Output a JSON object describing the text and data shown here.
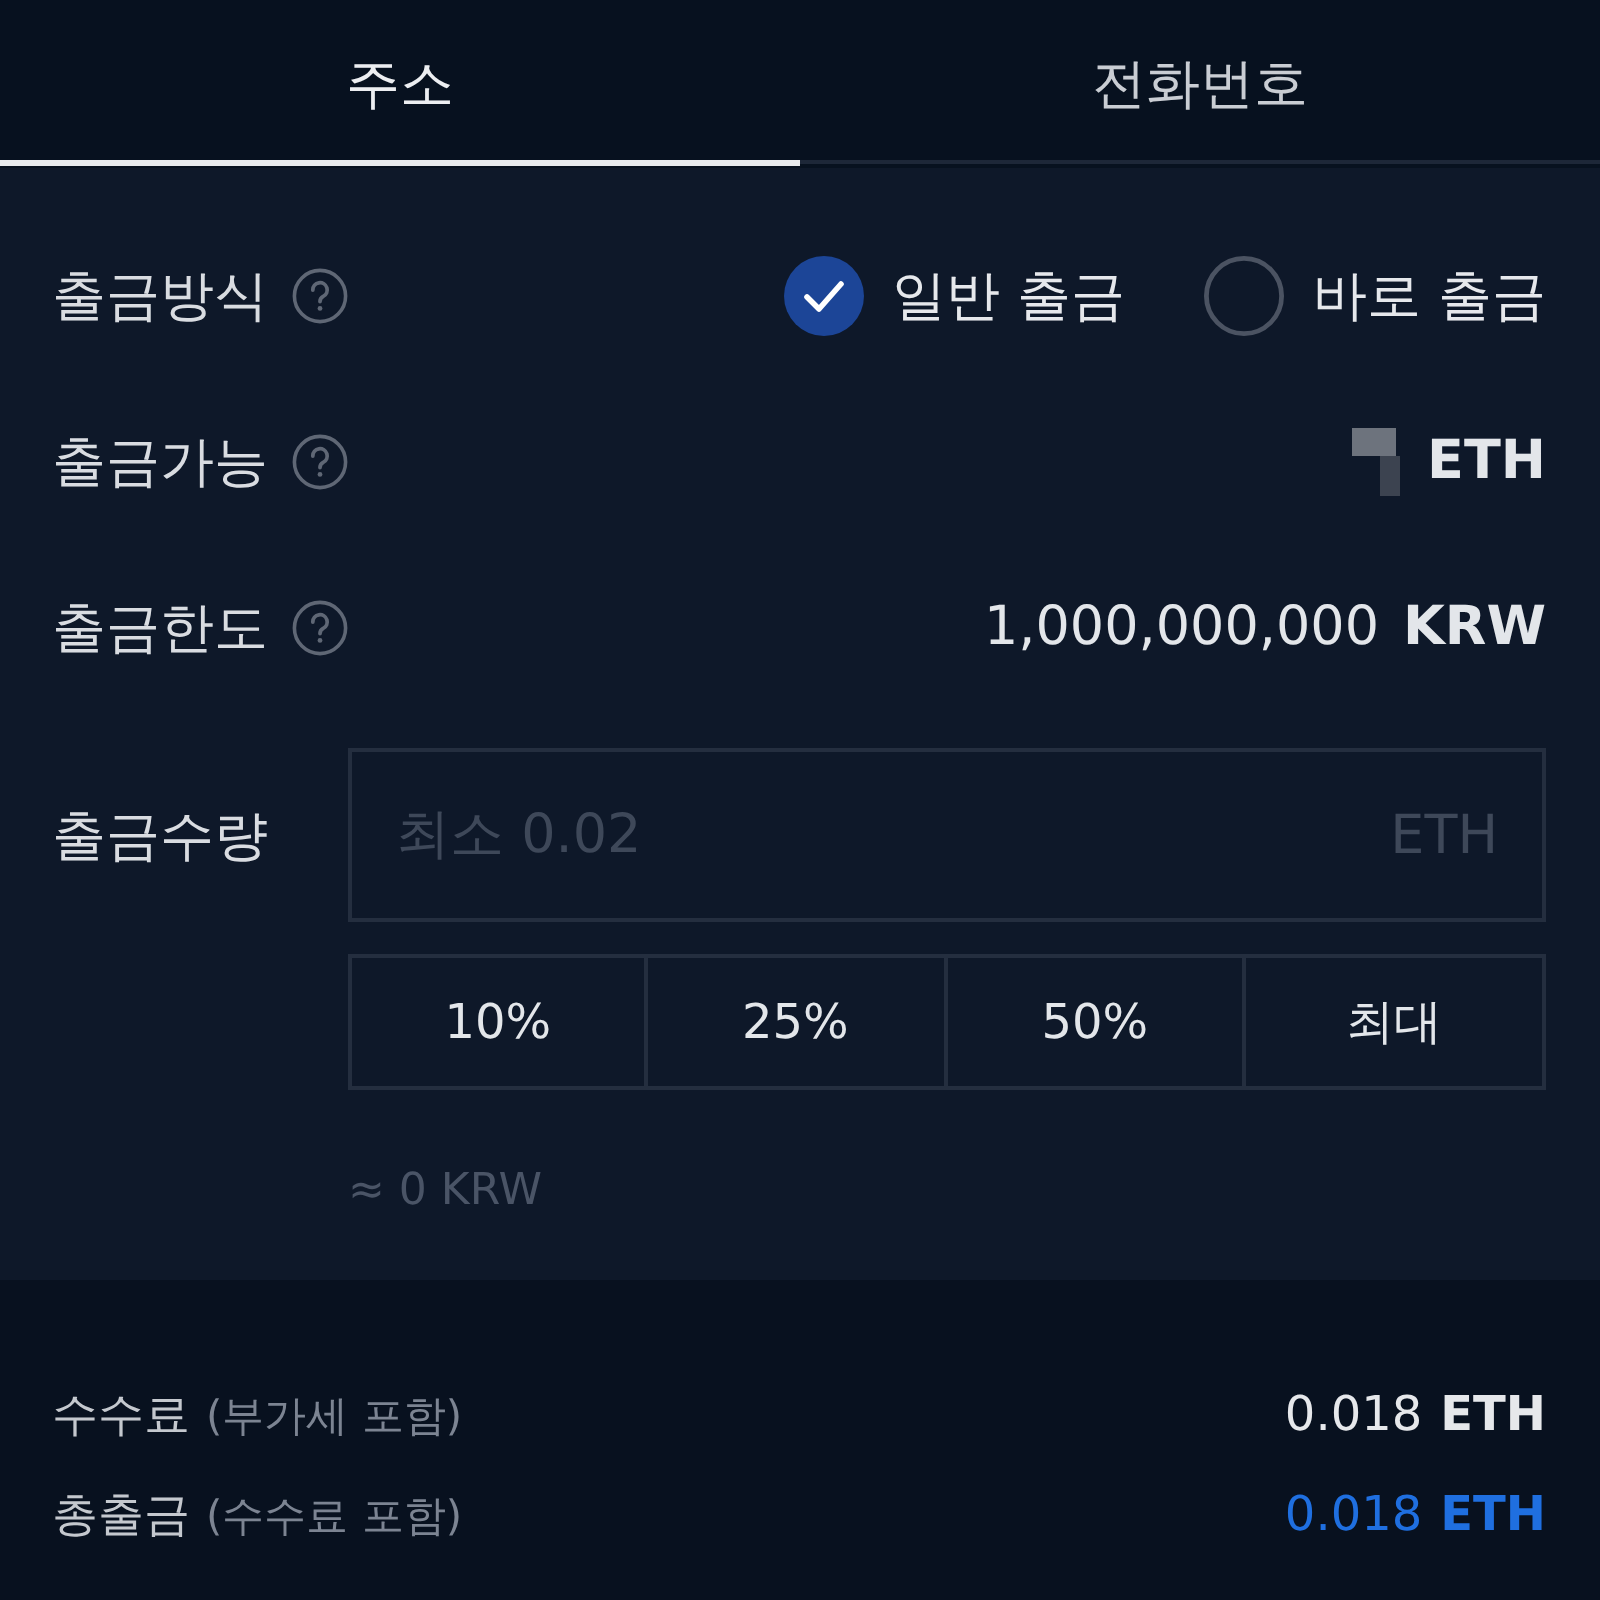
{
  "tabs": [
    {
      "label": "주소",
      "selected": true
    },
    {
      "label": "전화번호",
      "selected": false
    }
  ],
  "rows": [
    {
      "kind": "method",
      "label": "출금방식",
      "help": true,
      "options": [
        {
          "label": "일반 출금",
          "selected": true
        },
        {
          "label": "바로 출금",
          "selected": false
        }
      ]
    },
    {
      "kind": "available",
      "label": "출금가능",
      "help": true,
      "masked": true,
      "unit": "ETH"
    },
    {
      "kind": "limit",
      "label": "출금한도",
      "help": true,
      "value": "1,000,000,000",
      "unit": "KRW"
    }
  ],
  "amount": {
    "label": "출금수량",
    "placeholder": "최소 0.02",
    "unit": "ETH",
    "presets": [
      "10%",
      "25%",
      "50%",
      "최대"
    ],
    "estimate": "≈ 0 KRW"
  },
  "summary": [
    {
      "kind": "plain",
      "label": "수수료",
      "note": "(부가세 포함)",
      "value": "0.018",
      "unit": "ETH"
    },
    {
      "kind": "highlight",
      "label": "총출금",
      "note": "(수수료 포함)",
      "value": "0.018",
      "unit": "ETH"
    }
  ]
}
